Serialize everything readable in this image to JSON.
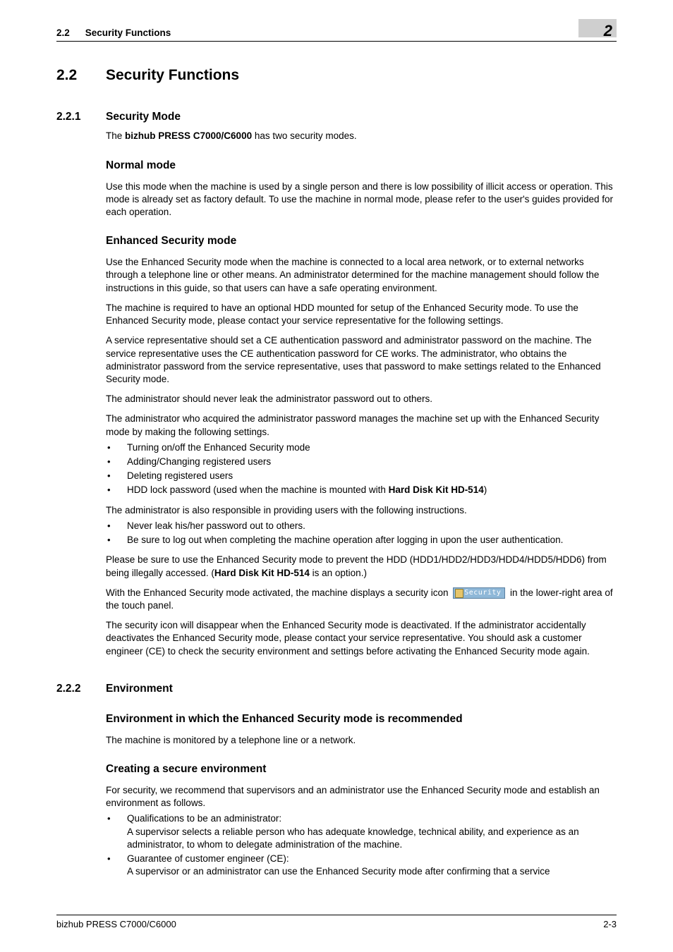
{
  "header": {
    "section_number": "2.2",
    "section_title": "Security Functions",
    "chapter_number": "2"
  },
  "h1": {
    "num": "2.2",
    "title": "Security Functions"
  },
  "s221": {
    "num": "2.2.1",
    "title": "Security Mode",
    "intro_pre": "The ",
    "intro_bold": "bizhub PRESS C7000/C6000",
    "intro_post": " has two security modes.",
    "normal": {
      "title": "Normal mode",
      "p1": "Use this mode when the machine is used by a single person and there is low possibility of illicit access or operation. This mode is already set as factory default. To use the machine in normal mode, please refer to the user's guides provided for each operation."
    },
    "enhanced": {
      "title": "Enhanced Security mode",
      "p1": "Use the Enhanced Security mode when the machine is connected to a local area network, or to external networks through a telephone line or other means. An administrator determined for the machine management should follow the instructions in this guide, so that users can have a safe operating environment.",
      "p2": "The machine is required to have an optional HDD mounted for setup of the Enhanced Security mode. To use the Enhanced Security mode, please contact your service representative for the following settings.",
      "p3": "A service representative should set a CE authentication password and administrator password on the machine. The service representative uses the CE authentication password for CE works. The administrator, who obtains the administrator password from the service representative, uses that password to make settings related to the Enhanced Security mode.",
      "p4": "The administrator should never leak the administrator password out to others.",
      "p5": "The administrator who acquired the administrator password manages the machine set up with the Enhanced Security mode by making the following settings.",
      "list1_0": "Turning on/off the Enhanced Security mode",
      "list1_1": "Adding/Changing registered users",
      "list1_2": "Deleting registered users",
      "list1_3_pre": "HDD lock password (used when the machine is mounted with ",
      "list1_3_bold": "Hard Disk Kit HD-514",
      "list1_3_post": ")",
      "p6": "The administrator is also responsible in providing users with the following instructions.",
      "list2_0": "Never leak his/her password out to others.",
      "list2_1": "Be sure to log out when completing the machine operation after logging in upon the user authentication.",
      "p7_pre": "Please be sure to use the Enhanced Security mode to prevent the HDD (HDD1/HDD2/HDD3/HDD4/HDD5/HDD6) from being illegally accessed. (",
      "p7_bold": "Hard Disk Kit HD-514",
      "p7_post": " is an option.)",
      "p8_pre": "With the Enhanced Security mode activated, the machine displays a security icon ",
      "p8_post": " in the lower-right area of the touch panel.",
      "icon_label": "Security",
      "p9": "The security icon will disappear when the Enhanced Security mode is deactivated. If the administrator accidentally deactivates the Enhanced Security mode, please contact your service representative. You should ask a customer engineer (CE) to check the security environment and settings before activating the Enhanced Security mode again."
    }
  },
  "s222": {
    "num": "2.2.2",
    "title": "Environment",
    "rec": {
      "title": "Environment in which the Enhanced Security mode is recommended",
      "p1": "The machine is monitored by a telephone line or a network."
    },
    "create": {
      "title": "Creating a secure environment",
      "p1": "For security, we recommend that supervisors and an administrator use the Enhanced Security mode and establish an environment as follows.",
      "b1_line1": "Qualifications to be an administrator:",
      "b1_line2": "A supervisor selects a reliable person who has adequate knowledge, technical ability, and experience as an administrator, to whom to delegate administration of the machine.",
      "b2_line1": "Guarantee of customer engineer (CE):",
      "b2_line2": "A supervisor or an administrator can use the Enhanced Security mode after confirming that a service"
    }
  },
  "footer": {
    "left": "bizhub PRESS C7000/C6000",
    "right": "2-3"
  }
}
